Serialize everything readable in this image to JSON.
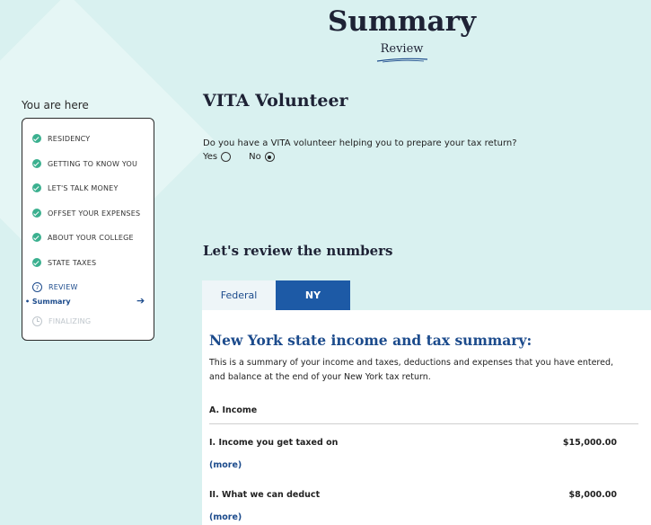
{
  "header": {
    "title": "Summary",
    "subtitle": "Review"
  },
  "sidebar": {
    "heading": "You are here",
    "steps": [
      {
        "label": "RESIDENCY",
        "status": "complete"
      },
      {
        "label": "GETTING TO KNOW YOU",
        "status": "complete"
      },
      {
        "label": "LET'S TALK MONEY",
        "status": "complete"
      },
      {
        "label": "OFFSET YOUR EXPENSES",
        "status": "complete"
      },
      {
        "label": "ABOUT YOUR COLLEGE",
        "status": "complete"
      },
      {
        "label": "STATE TAXES",
        "status": "complete"
      },
      {
        "label": "REVIEW",
        "status": "current",
        "number": "7"
      },
      {
        "label": "FINALIZING",
        "status": "upcoming"
      }
    ],
    "current_substep": "• Summary"
  },
  "vita": {
    "title": "VITA Volunteer",
    "question": "Do you have a VITA volunteer helping you to prepare your tax return?",
    "yes_label": "Yes",
    "no_label": "No",
    "selected": "No"
  },
  "review": {
    "title": "Let's review the numbers",
    "tabs": [
      {
        "label": "Federal",
        "active": false
      },
      {
        "label": "NY",
        "active": true
      }
    ]
  },
  "ny_summary": {
    "title": "New York state income and tax summary:",
    "description": "This is a summary of your income and taxes, deductions and expenses that you have entered, and balance at the end of your New York tax return.",
    "section_heading": "A. Income",
    "rows": [
      {
        "label": "I. Income you get taxed on",
        "amount": "$15,000.00",
        "link": "(more)"
      },
      {
        "label": "II. What we can deduct",
        "amount": "$8,000.00",
        "link": "(more)"
      }
    ]
  },
  "colors": {
    "background": "#d9f1f0",
    "navy_text": "#1e2235",
    "brand_blue": "#1c4b8c",
    "tab_active": "#1d5aa6",
    "check_green": "#3bb08f"
  }
}
